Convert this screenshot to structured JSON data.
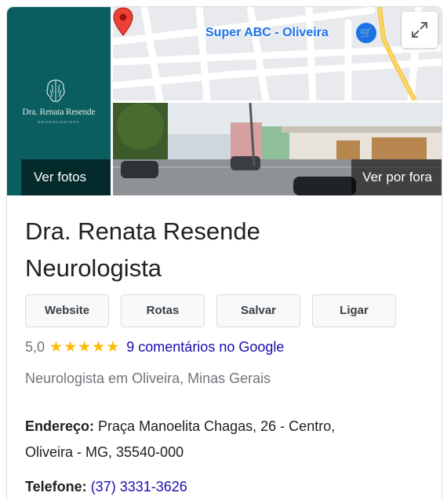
{
  "photos": {
    "logo_name": "Dra. Renata Resende",
    "logo_subtitle": "NEUROLOGISTA",
    "see_photos_label": "Ver fotos",
    "see_outside_label": "Ver por fora"
  },
  "map": {
    "place_label": "Super ABC - Oliveira",
    "place_icon": "shopping-cart-icon",
    "pin_icon": "location-pin-icon",
    "expand_icon": "expand-icon"
  },
  "business": {
    "name_line1": "Dra. Renata Resende",
    "name_line2": "Neurologista"
  },
  "actions": {
    "website": "Website",
    "routes": "Rotas",
    "save": "Salvar",
    "call": "Ligar"
  },
  "rating": {
    "value": "5,0",
    "stars": 5,
    "reviews_text": "9 comentários no Google"
  },
  "category": "Neurologista em Oliveira, Minas Gerais",
  "address": {
    "label": "Endereço:",
    "line1": "Praça Manoelita Chagas, 26 - Centro,",
    "line2": "Oliveira - MG, 35540-000"
  },
  "phone": {
    "label": "Telefone:",
    "number": "(37) 3331-3626"
  },
  "colors": {
    "logo_bg": "#0b5e60",
    "link": "#1a0dab",
    "star": "#fbbc04",
    "map_label": "#1a73e8",
    "pin": "#ea4335"
  }
}
